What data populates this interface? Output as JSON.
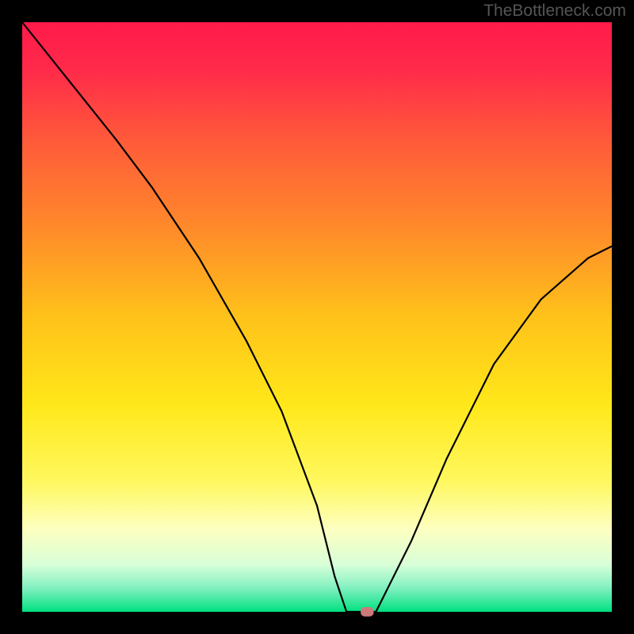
{
  "watermark": "TheBottleneck.com",
  "chart_data": {
    "type": "line",
    "title": "",
    "xlabel": "",
    "ylabel": "",
    "xlim": [
      0,
      100
    ],
    "ylim": [
      0,
      100
    ],
    "background": {
      "type": "vertical_gradient",
      "stops": [
        {
          "offset": 0.0,
          "color": "#ff1a4a"
        },
        {
          "offset": 0.08,
          "color": "#ff2a4a"
        },
        {
          "offset": 0.2,
          "color": "#ff5a3a"
        },
        {
          "offset": 0.35,
          "color": "#ff8a2a"
        },
        {
          "offset": 0.5,
          "color": "#ffc21a"
        },
        {
          "offset": 0.65,
          "color": "#ffe81a"
        },
        {
          "offset": 0.78,
          "color": "#fff860"
        },
        {
          "offset": 0.86,
          "color": "#fdffc0"
        },
        {
          "offset": 0.92,
          "color": "#d8ffd8"
        },
        {
          "offset": 0.96,
          "color": "#80f0c0"
        },
        {
          "offset": 1.0,
          "color": "#00e080"
        }
      ]
    },
    "series": [
      {
        "name": "bottleneck-curve",
        "color": "#000000",
        "width": 2.2,
        "x": [
          0,
          8,
          16,
          22,
          30,
          38,
          44,
          50,
          53,
          55,
          58,
          60,
          66,
          72,
          80,
          88,
          96,
          100
        ],
        "values": [
          100,
          90,
          80,
          72,
          60,
          46,
          34,
          18,
          6,
          0,
          0,
          0,
          12,
          26,
          42,
          53,
          60,
          62
        ]
      }
    ],
    "marker": {
      "name": "optimal-point",
      "x": 58.5,
      "y": 0,
      "width_pct": 2.2,
      "height_pct": 1.6,
      "color": "#cc7a7a"
    },
    "frame": {
      "border_color": "#000000",
      "border_width": 28
    }
  }
}
